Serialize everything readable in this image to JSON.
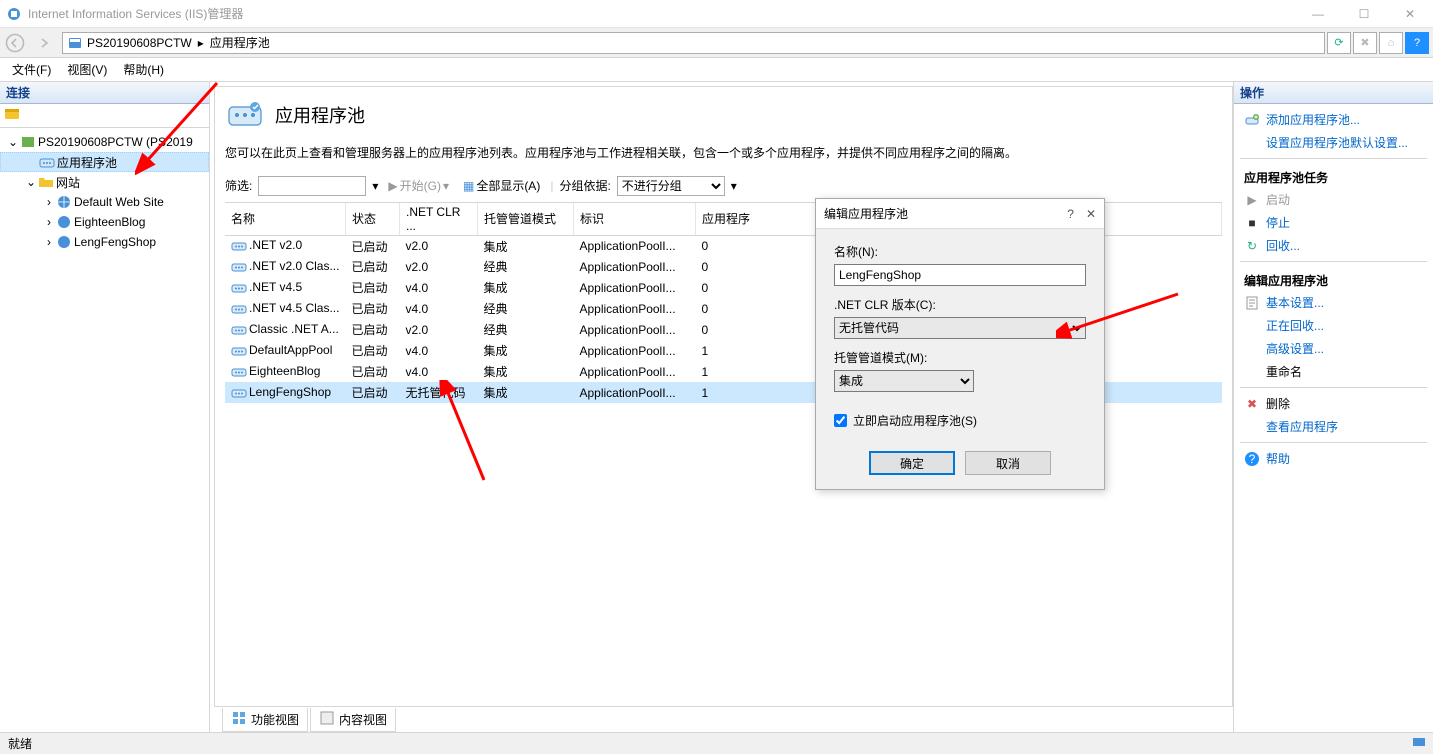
{
  "window": {
    "title": "Internet Information Services (IIS)管理器",
    "min": "—",
    "max": "☐",
    "close": "✕"
  },
  "breadcrumb": {
    "server": "PS20190608PCTW",
    "section": "应用程序池"
  },
  "menu": {
    "file": "文件(F)",
    "view": "视图(V)",
    "help": "帮助(H)"
  },
  "sidebar": {
    "header": "连接",
    "server": "PS20190608PCTW (PS2019",
    "apppools": "应用程序池",
    "sites": "网站",
    "site1": "Default Web Site",
    "site2": "EighteenBlog",
    "site3": "LengFengShop"
  },
  "main": {
    "title": "应用程序池",
    "desc": "您可以在此页上查看和管理服务器上的应用程序池列表。应用程序池与工作进程相关联，包含一个或多个应用程序，并提供不同应用程序之间的隔离。",
    "filter_label": "筛选:",
    "start_btn": "开始(G)",
    "show_all": "全部显示(A)",
    "groupby_label": "分组依据:",
    "groupby_value": "不进行分组",
    "cols": {
      "name": "名称",
      "state": "状态",
      "clr": ".NET CLR ...",
      "pipeline": "托管管道模式",
      "identity": "标识",
      "apps": "应用程序"
    },
    "rows": [
      {
        "name": ".NET v2.0",
        "state": "已启动",
        "clr": "v2.0",
        "pipeline": "集成",
        "identity": "ApplicationPoolI...",
        "apps": "0"
      },
      {
        "name": ".NET v2.0 Clas...",
        "state": "已启动",
        "clr": "v2.0",
        "pipeline": "经典",
        "identity": "ApplicationPoolI...",
        "apps": "0"
      },
      {
        "name": ".NET v4.5",
        "state": "已启动",
        "clr": "v4.0",
        "pipeline": "集成",
        "identity": "ApplicationPoolI...",
        "apps": "0"
      },
      {
        "name": ".NET v4.5 Clas...",
        "state": "已启动",
        "clr": "v4.0",
        "pipeline": "经典",
        "identity": "ApplicationPoolI...",
        "apps": "0"
      },
      {
        "name": "Classic .NET A...",
        "state": "已启动",
        "clr": "v2.0",
        "pipeline": "经典",
        "identity": "ApplicationPoolI...",
        "apps": "0"
      },
      {
        "name": "DefaultAppPool",
        "state": "已启动",
        "clr": "v4.0",
        "pipeline": "集成",
        "identity": "ApplicationPoolI...",
        "apps": "1"
      },
      {
        "name": "EighteenBlog",
        "state": "已启动",
        "clr": "v4.0",
        "pipeline": "集成",
        "identity": "ApplicationPoolI...",
        "apps": "1"
      },
      {
        "name": "LengFengShop",
        "state": "已启动",
        "clr": "无托管代码",
        "pipeline": "集成",
        "identity": "ApplicationPoolI...",
        "apps": "1"
      }
    ],
    "tabs": {
      "features": "功能视图",
      "content": "内容视图"
    }
  },
  "dialog": {
    "title": "编辑应用程序池",
    "name_label": "名称(N):",
    "name_value": "LengFengShop",
    "clr_label": ".NET CLR 版本(C):",
    "clr_value": "无托管代码",
    "pipeline_label": "托管管道模式(M):",
    "pipeline_value": "集成",
    "autostart": "立即启动应用程序池(S)",
    "ok": "确定",
    "cancel": "取消"
  },
  "actions": {
    "header": "操作",
    "add": "添加应用程序池...",
    "defaults": "设置应用程序池默认设置...",
    "tasks": "应用程序池任务",
    "start": "启动",
    "stop": "停止",
    "recycle": "回收...",
    "edit": "编辑应用程序池",
    "basic": "基本设置...",
    "recycling": "正在回收...",
    "advanced": "高级设置...",
    "rename": "重命名",
    "delete": "删除",
    "viewapps": "查看应用程序",
    "help": "帮助"
  },
  "status": {
    "text": "就绪"
  }
}
